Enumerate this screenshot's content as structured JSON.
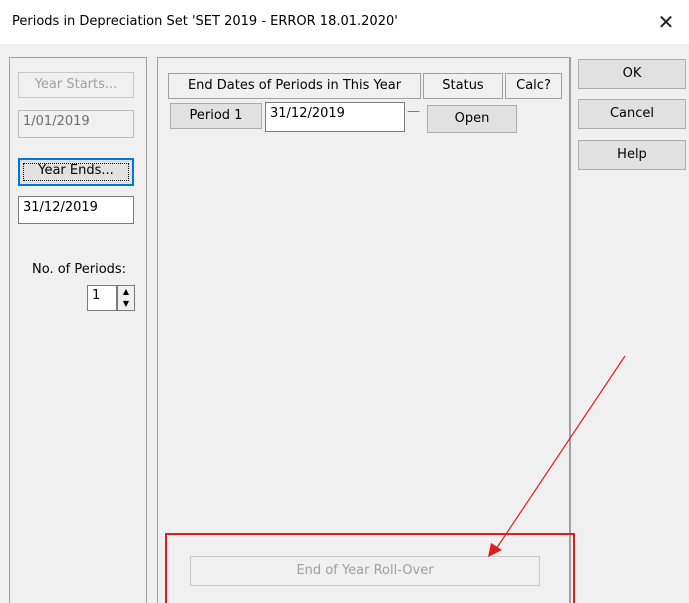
{
  "window": {
    "title": "Periods in Depreciation Set 'SET 2019 - ERROR 18.01.2020'",
    "close_glyph": "✕"
  },
  "left": {
    "year_starts_label": "Year Starts...",
    "year_starts_value": "1/01/2019",
    "year_ends_label": "Year Ends...",
    "year_ends_value": "31/12/2019",
    "periods_label": "No. of Periods:",
    "periods_value": "1"
  },
  "table": {
    "headers": {
      "end_dates": "End Dates of Periods in This Year",
      "status": "Status",
      "calc": "Calc?"
    },
    "rows": [
      {
        "period": "Period 1",
        "end_date": "31/12/2019",
        "dash": "—",
        "status": "Open"
      }
    ]
  },
  "actions": {
    "ok": "OK",
    "cancel": "Cancel",
    "help": "Help"
  },
  "rollover": {
    "label": "End of Year Roll-Over"
  },
  "annotation": {
    "color": "#e21b1b"
  }
}
